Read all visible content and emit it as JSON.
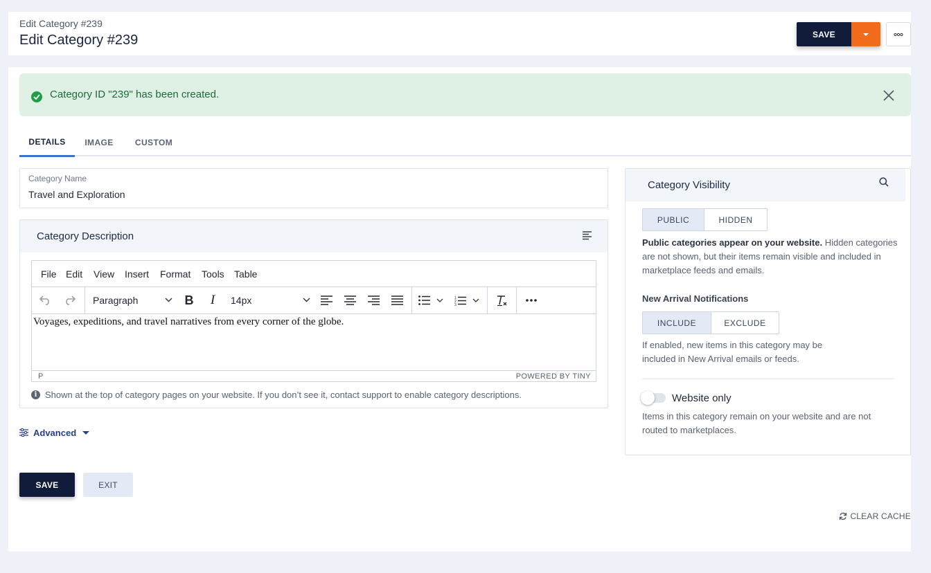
{
  "header": {
    "breadcrumb": "Edit Category #239",
    "title": "Edit Category #239",
    "save_label": "SAVE"
  },
  "alert": {
    "message": "Category ID \"239\" has been created."
  },
  "tabs": [
    {
      "label": "DETAILS",
      "active": true
    },
    {
      "label": "IMAGE",
      "active": false
    },
    {
      "label": "CUSTOM",
      "active": false
    }
  ],
  "category_name": {
    "label": "Category Name",
    "value": "Travel and Exploration"
  },
  "description": {
    "title": "Category Description",
    "menu": [
      "File",
      "Edit",
      "View",
      "Insert",
      "Format",
      "Tools",
      "Table"
    ],
    "block_format": "Paragraph",
    "font_size": "14px",
    "content": "Voyages, expeditions, and travel narratives from every corner of the globe.",
    "status_path": "P",
    "powered_by": "POWERED BY TINY",
    "help_text": "Shown at the top of category pages on your website. If you don’t see it, contact support to enable category descriptions."
  },
  "advanced": {
    "label": "Advanced"
  },
  "footer": {
    "save_label": "SAVE",
    "exit_label": "EXIT",
    "clear_cache_label": "CLEAR CACHE"
  },
  "visibility": {
    "title": "Category Visibility",
    "options": [
      "PUBLIC",
      "HIDDEN"
    ],
    "selected": "PUBLIC",
    "description_bold": "Public categories appear on your website.",
    "description_rest": " Hidden categories are not shown, but their items remain visible and included in marketplace feeds and emails.",
    "notifications_heading": "New Arrival Notifications",
    "notification_options": [
      "INCLUDE",
      "EXCLUDE"
    ],
    "notification_selected": "INCLUDE",
    "notifications_text": "If enabled, new items in this category may be included in New Arrival emails or feeds.",
    "website_only_label": "Website only",
    "website_only_enabled": false,
    "website_only_text": "Items in this category remain on your website and are not routed to marketplaces."
  },
  "colors": {
    "primary": "#101c3a",
    "accent": "#f26b1d",
    "success_bg": "#dff1e5",
    "success": "#1f9d49",
    "tab_active": "#3b73c7",
    "link": "#27408b"
  }
}
